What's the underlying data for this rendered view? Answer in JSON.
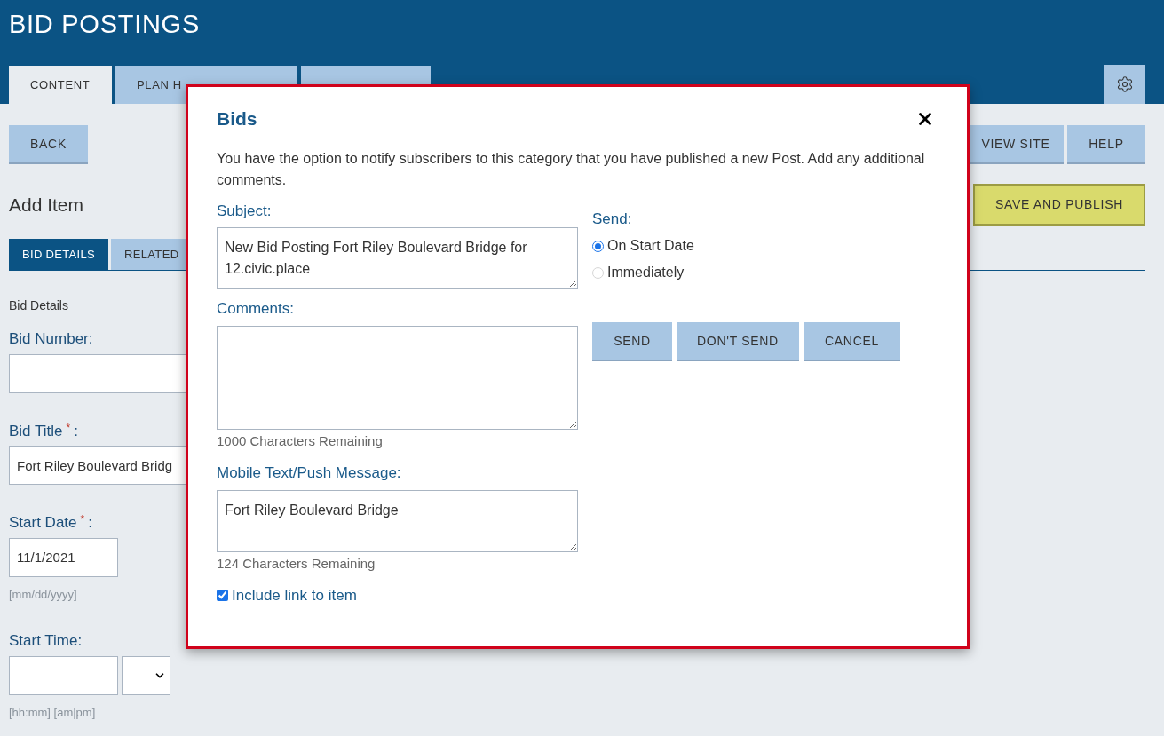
{
  "header": {
    "title": "BID POSTINGS"
  },
  "tabs": [
    {
      "label": "CONTENT",
      "selected": true
    },
    {
      "label": "PLAN H",
      "selected": false
    },
    {
      "selected": false
    }
  ],
  "toolbar": {
    "left_buttons": [
      "BACK"
    ],
    "right_buttons": [
      "VIEW SITE",
      "HELP"
    ]
  },
  "page_title": "Add Item",
  "primary_button": "SAVE AND PUBLISH",
  "sub_tabs": [
    {
      "label": "BID DETAILS",
      "selected": true
    },
    {
      "label": "RELATED",
      "selected": false
    }
  ],
  "section_title": "Bid Details",
  "fields": [
    {
      "kind": "text",
      "label": "Bid Number:"
    },
    {
      "kind": "text",
      "label": "Bid Title",
      "required_mark": "*",
      "colon": ":",
      "value": "Fort Riley Boulevard Bridg"
    },
    {
      "kind": "date",
      "label": "Start Date",
      "required_mark": "*",
      "colon": ":",
      "value": "11/1/2021",
      "hint": "[mm/dd/yyyy]"
    },
    {
      "kind": "time",
      "label": "Start Time:",
      "hint": "[hh:mm] [am|pm]"
    }
  ],
  "modal": {
    "title": "Bids",
    "intro": "You have the option to notify subscribers to this category that you have published a new Post. Add any additional comments.",
    "subject": {
      "label": "Subject:",
      "value": "New Bid Posting Fort Riley Boulevard Bridge for 12.civic.place"
    },
    "comments": {
      "label": "Comments:",
      "counter": "1000 Characters Remaining"
    },
    "mobile": {
      "label": "Mobile Text/Push Message:",
      "value": "Fort Riley Boulevard Bridge",
      "counter": "124 Characters Remaining"
    },
    "include_link": {
      "label": "Include link to item",
      "checked": true
    },
    "send": {
      "label": "Send:",
      "options": [
        {
          "label": "On Start Date",
          "selected": true
        },
        {
          "label": "Immediately",
          "selected": false
        }
      ]
    },
    "buttons": [
      "SEND",
      "DON'T SEND",
      "CANCEL"
    ]
  }
}
